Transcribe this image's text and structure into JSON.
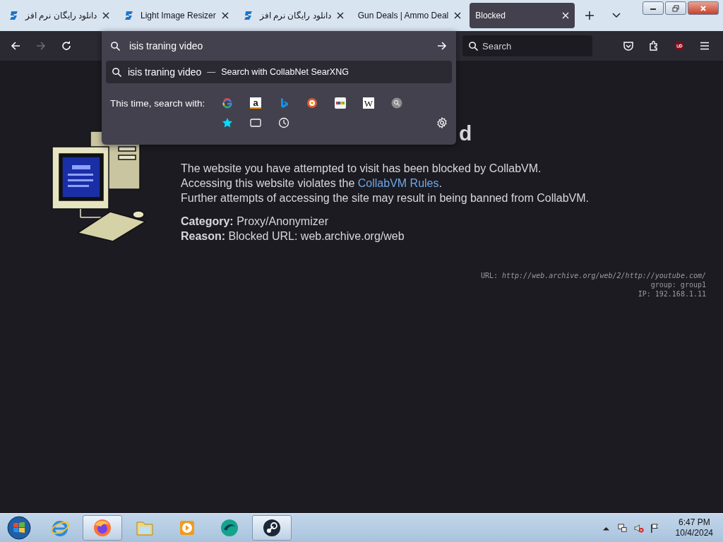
{
  "tabs": [
    {
      "title": "دانلود رایگان نرم افز",
      "favicon": true,
      "selected": false
    },
    {
      "title": "Light Image Resizer",
      "favicon": true,
      "selected": false
    },
    {
      "title": "دانلود رایگان نرم افز",
      "favicon": true,
      "selected": false
    },
    {
      "title": "Gun Deals | Ammo Deal",
      "favicon": false,
      "selected": false
    },
    {
      "title": "Blocked",
      "favicon": false,
      "selected": true
    }
  ],
  "nav": {
    "back_disabled": false,
    "forward_disabled": true
  },
  "address_bar": {
    "value": "isis traning video"
  },
  "search_field": {
    "placeholder": "Search"
  },
  "popup": {
    "suggestion": {
      "query": "isis traning video",
      "separator": "—",
      "action": "Search with CollabNet SearXNG"
    },
    "engines_label": "This time, search with:",
    "engines": [
      {
        "kind": "google"
      },
      {
        "kind": "amazon",
        "label": "a"
      },
      {
        "kind": "bing"
      },
      {
        "kind": "duckduckgo"
      },
      {
        "kind": "ebay"
      },
      {
        "kind": "wikipedia",
        "label": "W"
      },
      {
        "kind": "other"
      }
    ],
    "modes": [
      {
        "kind": "bookmarks"
      },
      {
        "kind": "tabs"
      },
      {
        "kind": "history"
      }
    ]
  },
  "page": {
    "heading": "d",
    "lines": [
      "The website you have attempted to visit has been blocked by CollabVM."
    ],
    "rules_line": {
      "before": "Accessing this website violates the ",
      "link": "CollabVM Rules",
      "after": "."
    },
    "warning": "Further attempts of accessing the site may result in being banned from CollabVM.",
    "details": [
      "**Category:** Proxy/Anonymizer",
      "**Reason:** Blocked URL: web.archive.org/web"
    ],
    "debug": [
      "URL: *http://web.archive.org/web/2/http://youtube.com/*",
      "group: group1",
      "IP: 192.168.1.11"
    ]
  },
  "taskbar": {
    "apps": [
      {
        "kind": "ie",
        "active": false
      },
      {
        "kind": "firefox",
        "active": true
      },
      {
        "kind": "explorer",
        "active": false
      },
      {
        "kind": "media",
        "active": false
      },
      {
        "kind": "bubble",
        "active": false
      },
      {
        "kind": "steam",
        "active": true
      }
    ],
    "time": "6:47 PM",
    "date": "10/4/2024"
  }
}
